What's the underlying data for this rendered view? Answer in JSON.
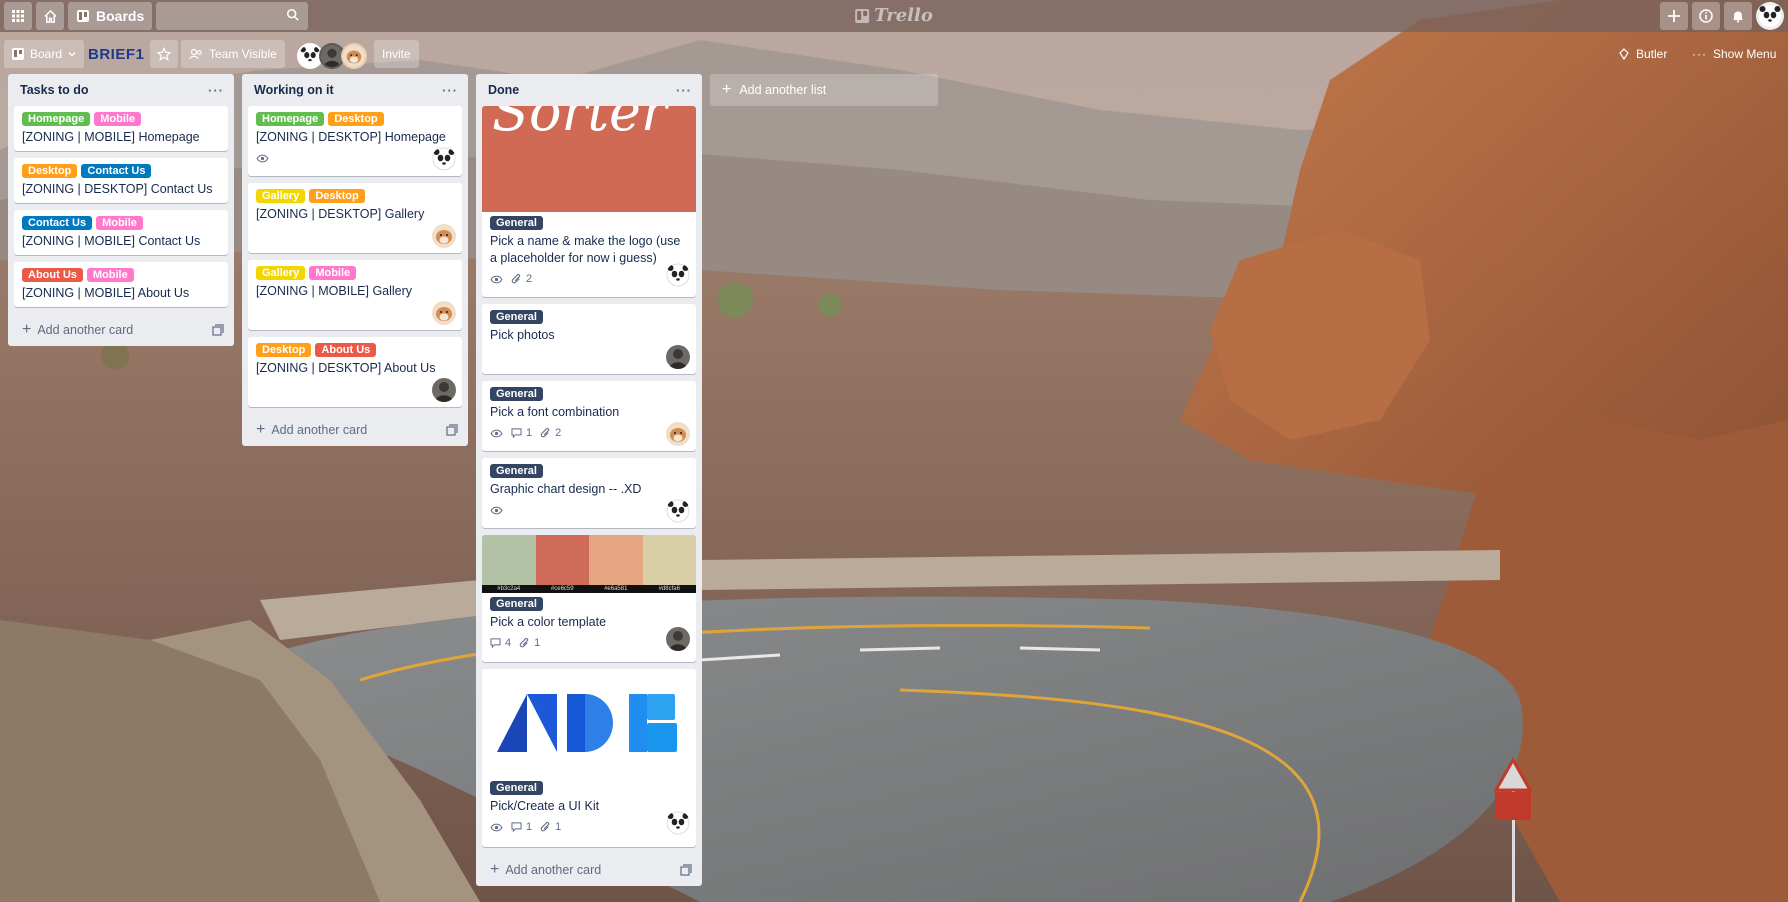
{
  "header": {
    "boards_label": "Boards",
    "search_placeholder": "",
    "logo_text": "Trello"
  },
  "board": {
    "view_label": "Board",
    "name": "BRIEF1",
    "visibility_label": "Team Visible",
    "invite_label": "Invite",
    "butler_label": "Butler",
    "show_menu_label": "Show Menu"
  },
  "add_card_label": "Add another card",
  "add_list_label": "Add another list",
  "colors": {
    "green": "#61bd4f",
    "pink": "#ff78cb",
    "orange": "#ff9f1a",
    "blue": "#0079bf",
    "red": "#eb5a46",
    "yellow": "#f2d600",
    "navy": "#344563",
    "list_bg": "#ebecf0"
  },
  "lists": [
    {
      "title": "Tasks to do",
      "cards": [
        {
          "labels": [
            "Homepage",
            "Mobile"
          ],
          "title": "[ZONING | MOBILE] Homepage"
        },
        {
          "labels": [
            "Desktop",
            "Contact Us"
          ],
          "title": "[ZONING | DESKTOP] Contact Us"
        },
        {
          "labels": [
            "Contact Us",
            "Mobile"
          ],
          "title": "[ZONING | MOBILE] Contact Us"
        },
        {
          "labels": [
            "About Us",
            "Mobile"
          ],
          "title": "[ZONING | MOBILE] About Us"
        }
      ]
    },
    {
      "title": "Working on it",
      "cards": [
        {
          "labels": [
            "Homepage",
            "Desktop"
          ],
          "title": "[ZONING | DESKTOP] Homepage"
        },
        {
          "labels": [
            "Gallery",
            "Desktop"
          ],
          "title": "[ZONING | DESKTOP] Gallery"
        },
        {
          "labels": [
            "Gallery",
            "Mobile"
          ],
          "title": "[ZONING | MOBILE] Gallery"
        },
        {
          "labels": [
            "Desktop",
            "About Us"
          ],
          "title": "[ZONING | DESKTOP] About Us"
        }
      ]
    },
    {
      "title": "Done",
      "cards": [
        {
          "cover_text": "Sorter",
          "labels": [
            "General"
          ],
          "title": "Pick a name & make the logo (use a placeholder for now i guess)",
          "attachments": "2"
        },
        {
          "labels": [
            "General"
          ],
          "title": "Pick photos"
        },
        {
          "labels": [
            "General"
          ],
          "title": "Pick a font combination",
          "comments": "1",
          "attachments": "2"
        },
        {
          "labels": [
            "General"
          ],
          "title": "Graphic chart design -- .XD"
        },
        {
          "palette": [
            {
              "color": "#b3c2a4",
              "code": "#b3c2a4"
            },
            {
              "color": "#ce6c59",
              "code": "#ce6c59"
            },
            {
              "color": "#e6a581",
              "code": "#e6a581"
            },
            {
              "color": "#d8cfa6",
              "code": "#d8cfa6"
            }
          ],
          "labels": [
            "General"
          ],
          "title": "Pick a color template",
          "comments": "4",
          "attachments": "1"
        },
        {
          "labels": [
            "General"
          ],
          "title": "Pick/Create a UI Kit",
          "comments": "1",
          "attachments": "1"
        }
      ]
    }
  ]
}
